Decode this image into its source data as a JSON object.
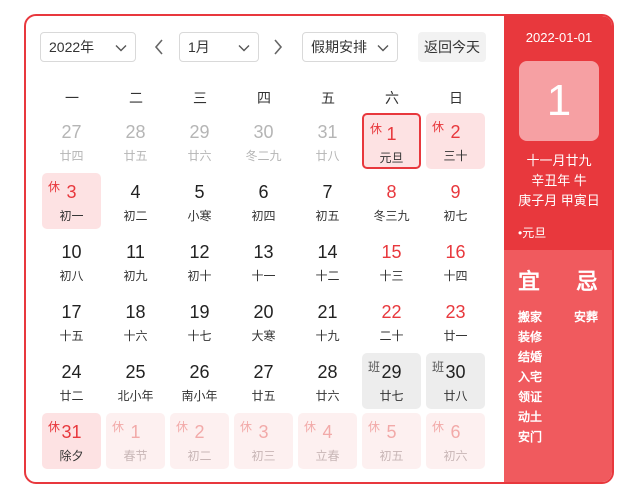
{
  "toolbar": {
    "year": "2022年",
    "month": "1月",
    "holiday": "假期安排",
    "today": "返回今天"
  },
  "weekdays": [
    "一",
    "二",
    "三",
    "四",
    "五",
    "六",
    "日"
  ],
  "days": [
    {
      "n": "27",
      "l": "廿四",
      "type": "other"
    },
    {
      "n": "28",
      "l": "廿五",
      "type": "other"
    },
    {
      "n": "29",
      "l": "廿六",
      "type": "other"
    },
    {
      "n": "30",
      "l": "冬二九",
      "type": "other"
    },
    {
      "n": "31",
      "l": "廿八",
      "type": "other"
    },
    {
      "n": "1",
      "l": "元旦",
      "type": "holiday selected",
      "tag": "休"
    },
    {
      "n": "2",
      "l": "三十",
      "type": "holiday",
      "tag": "休"
    },
    {
      "n": "3",
      "l": "初一",
      "type": "holiday",
      "tag": "休"
    },
    {
      "n": "4",
      "l": "初二",
      "type": ""
    },
    {
      "n": "5",
      "l": "小寒",
      "type": ""
    },
    {
      "n": "6",
      "l": "初四",
      "type": ""
    },
    {
      "n": "7",
      "l": "初五",
      "type": ""
    },
    {
      "n": "8",
      "l": "冬三九",
      "type": "red"
    },
    {
      "n": "9",
      "l": "初七",
      "type": "red"
    },
    {
      "n": "10",
      "l": "初八",
      "type": ""
    },
    {
      "n": "11",
      "l": "初九",
      "type": ""
    },
    {
      "n": "12",
      "l": "初十",
      "type": ""
    },
    {
      "n": "13",
      "l": "十一",
      "type": ""
    },
    {
      "n": "14",
      "l": "十二",
      "type": ""
    },
    {
      "n": "15",
      "l": "十三",
      "type": "red"
    },
    {
      "n": "16",
      "l": "十四",
      "type": "red"
    },
    {
      "n": "17",
      "l": "十五",
      "type": ""
    },
    {
      "n": "18",
      "l": "十六",
      "type": ""
    },
    {
      "n": "19",
      "l": "十七",
      "type": ""
    },
    {
      "n": "20",
      "l": "大寒",
      "type": ""
    },
    {
      "n": "21",
      "l": "十九",
      "type": ""
    },
    {
      "n": "22",
      "l": "二十",
      "type": "red"
    },
    {
      "n": "23",
      "l": "廿一",
      "type": "red"
    },
    {
      "n": "24",
      "l": "廿二",
      "type": ""
    },
    {
      "n": "25",
      "l": "北小年",
      "type": ""
    },
    {
      "n": "26",
      "l": "南小年",
      "type": ""
    },
    {
      "n": "27",
      "l": "廿五",
      "type": ""
    },
    {
      "n": "28",
      "l": "廿六",
      "type": ""
    },
    {
      "n": "29",
      "l": "廿七",
      "type": "work",
      "tag": "班"
    },
    {
      "n": "30",
      "l": "廿八",
      "type": "work",
      "tag": "班"
    },
    {
      "n": "31",
      "l": "除夕",
      "type": "holiday",
      "tag": "休"
    },
    {
      "n": "1",
      "l": "春节",
      "type": "holiday-faded",
      "tag": "休"
    },
    {
      "n": "2",
      "l": "初二",
      "type": "holiday-faded",
      "tag": "休"
    },
    {
      "n": "3",
      "l": "初三",
      "type": "holiday-faded",
      "tag": "休"
    },
    {
      "n": "4",
      "l": "立春",
      "type": "holiday-faded",
      "tag": "休"
    },
    {
      "n": "5",
      "l": "初五",
      "type": "holiday-faded",
      "tag": "休"
    },
    {
      "n": "6",
      "l": "初六",
      "type": "holiday-faded",
      "tag": "休"
    }
  ],
  "sidebar": {
    "date": "2022-01-01",
    "big_day": "1",
    "lunar_date": "十一月廿九",
    "ganzhi_year": "辛丑年 牛",
    "ganzhi_month_day": "庚子月 甲寅日",
    "festival": "•元旦",
    "yi_title": "宜",
    "ji_title": "忌",
    "yi_items": [
      "搬家",
      "装修",
      "结婚",
      "入宅",
      "领证",
      "动土",
      "安门"
    ],
    "ji_items": [
      "安葬"
    ]
  },
  "colors": {
    "accent": "#e8383d",
    "holiday_bg": "#fde2e3",
    "work_bg": "#ededed",
    "sidebar_bottom": "#f05a5e"
  }
}
